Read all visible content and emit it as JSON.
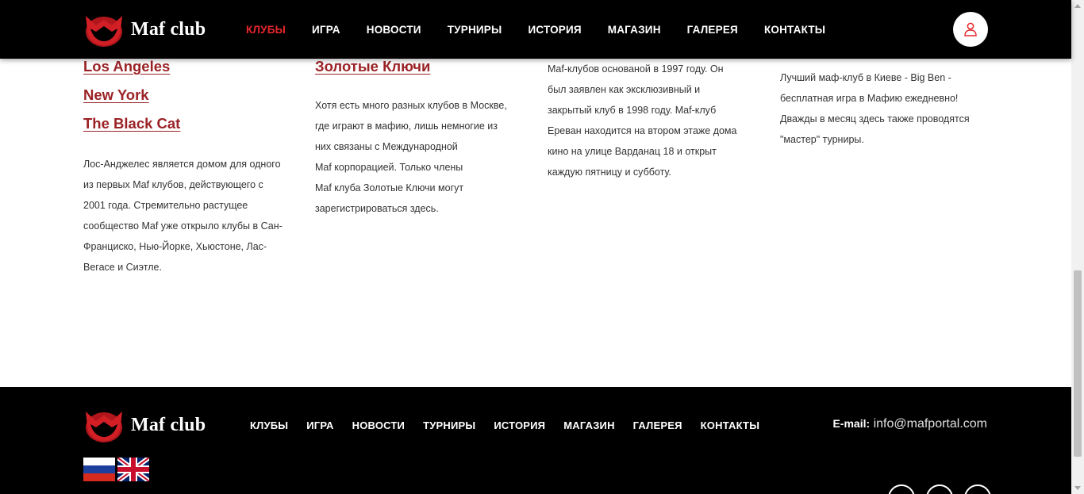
{
  "header": {
    "logo_text": "Maf club",
    "nav": [
      "КЛУБЫ",
      "ИГРА",
      "НОВОСТИ",
      "ТУРНИРЫ",
      "ИСТОРИЯ",
      "МАГАЗИН",
      "ГАЛЕРЕЯ",
      "КОНТАКТЫ"
    ],
    "active_index": 0
  },
  "columns": [
    {
      "links": [
        "Los Angeles",
        "New York",
        "The Black Cat"
      ],
      "lines": [
        "Лос-Анджелес является домом для одного",
        "из первых Maf клубов, действующего с",
        "2001 года. Стремительно растущее",
        "сообщество Maf уже открыло клубы в Сан-",
        "Франциско, Нью-Йорке, Хьюстоне, Лас-",
        "Вегасе и Сиэтле."
      ]
    },
    {
      "links": [
        "Золотые Ключи"
      ],
      "lines": [
        "Хотя есть много разных клубов в Москве,",
        "где играют в мафию, лишь немногие из",
        "них связаны с Международной",
        "Maf корпорацией. Только члены",
        "Maf клуба Золотые Ключи могут",
        "зарегистрироваться здесь."
      ]
    },
    {
      "links": [],
      "lines": [
        "Maf-клубов основаной в 1997 году. Он",
        "был заявлен как эксклюзивный и",
        "закрытый клуб в 1998 году. Maf-клуб",
        "Ереван находится на втором этаже дома",
        "кино на улице Варданац 18 и открыт",
        "каждую пятницу и субботу."
      ]
    },
    {
      "links": [],
      "lines": [
        "Лучший маф-клуб в Киеве - Big Ben -",
        "бесплатная игра в Мафию ежедневно!",
        "Дважды в месяц здесь также проводятся",
        "\"мастер\" турниры."
      ]
    }
  ],
  "footer": {
    "logo_text": "Maf club",
    "nav": [
      "КЛУБЫ",
      "ИГРА",
      "НОВОСТИ",
      "ТУРНИРЫ",
      "ИСТОРИЯ",
      "МАГАЗИН",
      "ГАЛЕРЕЯ",
      "КОНТАКТЫ"
    ],
    "email_label": "E-mail:",
    "email": "info@mafportal.com"
  },
  "colors": {
    "accent": "#e8262b",
    "link": "#9b2226",
    "bar": "#000000"
  },
  "icons": [
    "logo-icon",
    "user-icon",
    "russian-flag-icon",
    "uk-flag-icon",
    "social-icon"
  ]
}
